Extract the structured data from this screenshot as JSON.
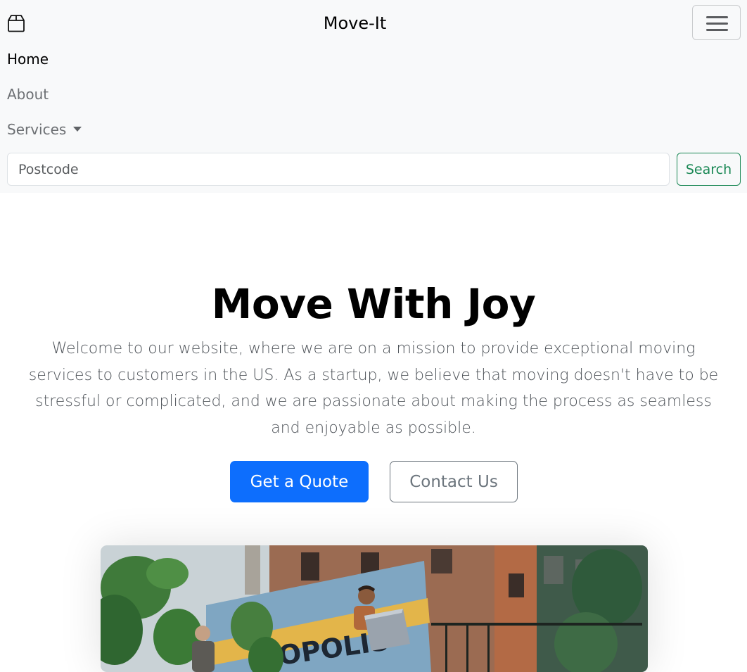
{
  "navbar": {
    "brand_icon": "box-icon",
    "brand_title": "Move-It",
    "toggler_icon": "hamburger-menu-icon",
    "links": {
      "home": "Home",
      "about": "About",
      "services": "Services"
    },
    "services_caret_icon": "caret-down-icon",
    "search": {
      "placeholder": "Postcode",
      "value": "",
      "button_label": "Search"
    }
  },
  "hero": {
    "title": "Move With Joy",
    "text": "Welcome to our website, where we are on a mission to provide exceptional moving services to customers in the US. As a startup, we believe that moving doesn't have to be stressful or complicated, and we are passionate about making the process as seamless and enjoyable as possible.",
    "primary_button": "Get a Quote",
    "secondary_button": "Contact Us"
  },
  "image": {
    "truck_lettering": "OPOLIS"
  },
  "colors": {
    "navbar_bg": "#f8f9fa",
    "primary": "#0d6efd",
    "success": "#198754",
    "secondary": "#6c757d"
  }
}
